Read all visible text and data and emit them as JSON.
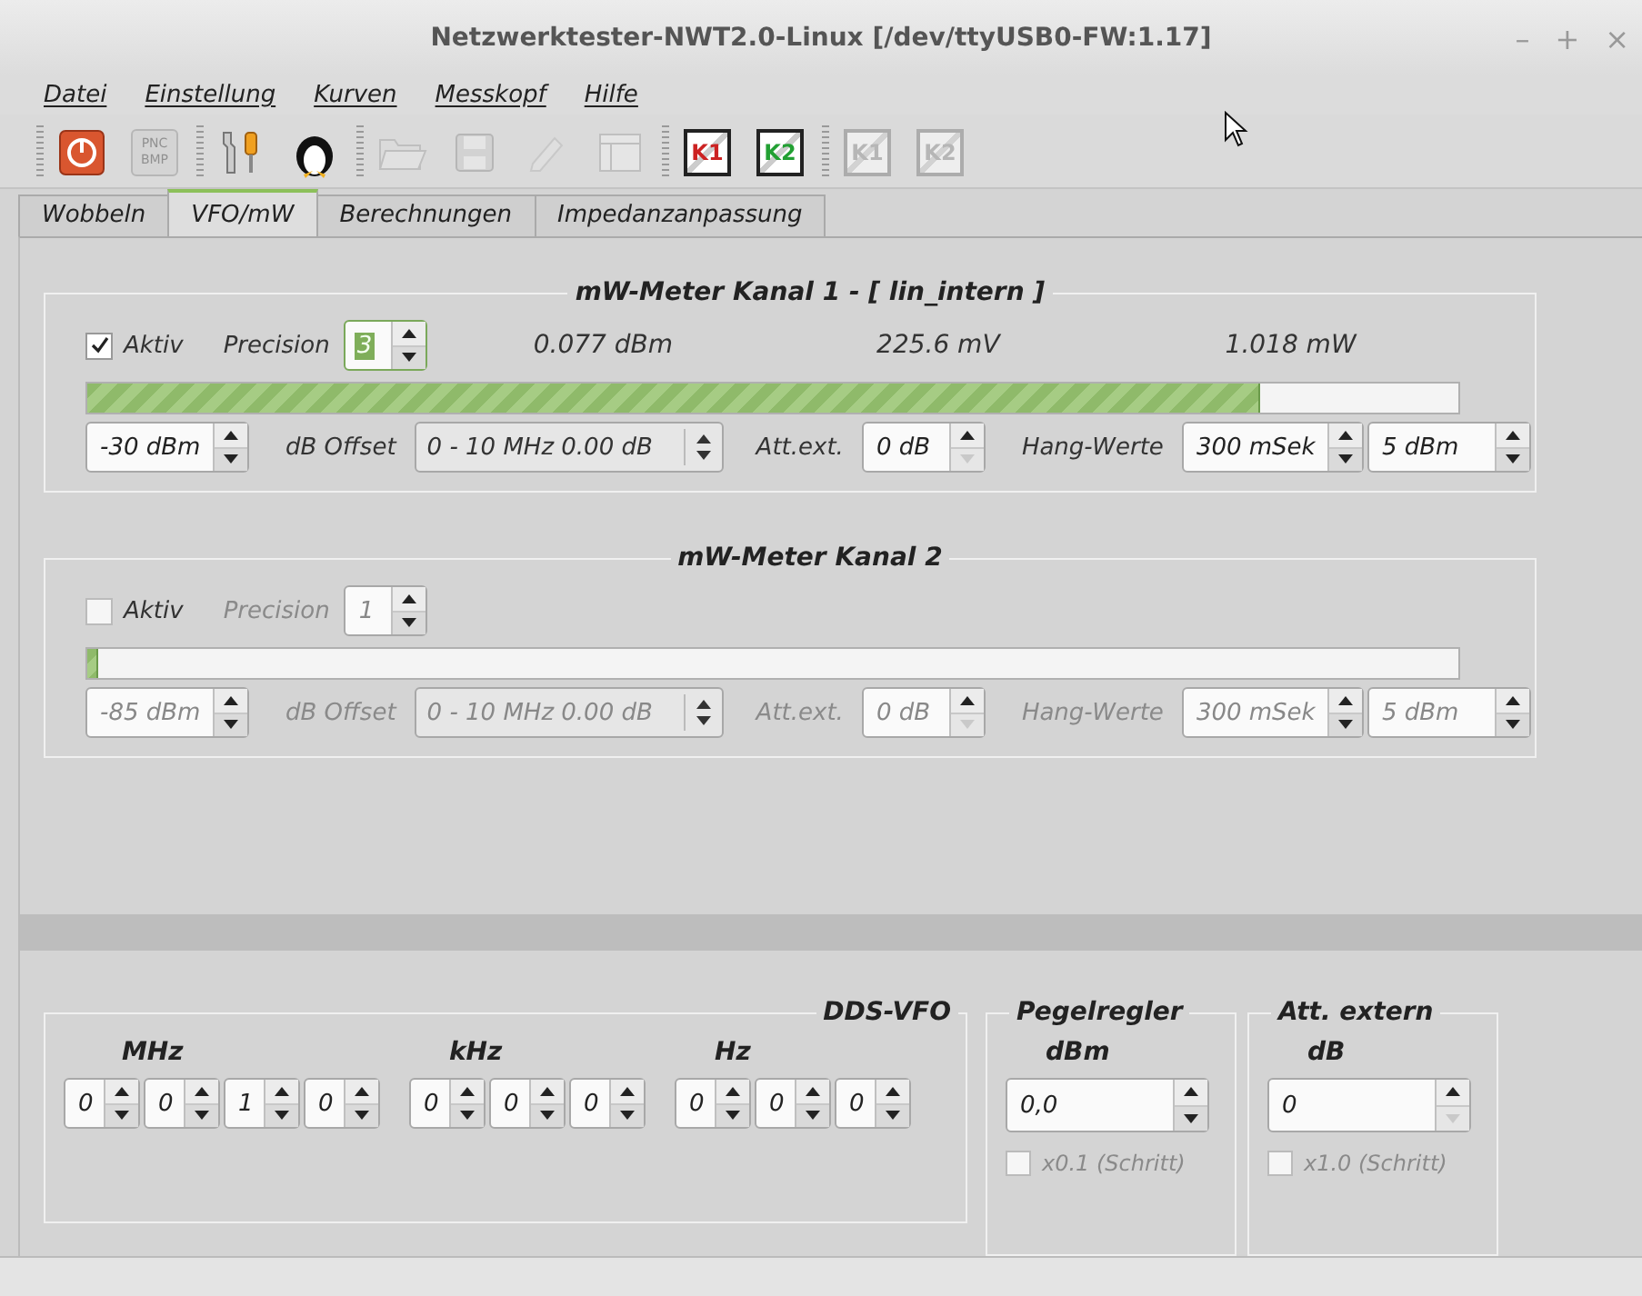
{
  "window": {
    "title": "Netzwerktester-NWT2.0-Linux [/dev/ttyUSB0-FW:1.17]",
    "controls": [
      "–",
      "+",
      "×"
    ]
  },
  "menu": [
    {
      "label": "Datei"
    },
    {
      "label": "Einstellung"
    },
    {
      "label": "Kurven"
    },
    {
      "label": "Messkopf"
    },
    {
      "label": "Hilfe"
    }
  ],
  "toolbar": [
    [
      {
        "kind": "power",
        "disabled": false
      },
      {
        "kind": "pnc",
        "label": "PNC BMP",
        "disabled": true
      }
    ],
    [
      {
        "kind": "tools",
        "disabled": false
      },
      {
        "kind": "penguin",
        "disabled": false
      }
    ],
    [
      {
        "kind": "folder",
        "disabled": true
      },
      {
        "kind": "floppy",
        "disabled": true
      },
      {
        "kind": "pencil",
        "disabled": true
      },
      {
        "kind": "window",
        "disabled": true
      }
    ],
    [
      {
        "kind": "probe",
        "label": "K1",
        "color": "#cc2222",
        "disabled": false
      },
      {
        "kind": "probe",
        "label": "K2",
        "color": "#22a033",
        "disabled": false
      }
    ],
    [
      {
        "kind": "probe",
        "label": "K1",
        "disabled": true
      },
      {
        "kind": "probe",
        "label": "K2",
        "disabled": true
      }
    ]
  ],
  "tabs": [
    {
      "label": "Wobbeln",
      "selected": false
    },
    {
      "label": "VFO/mW",
      "selected": true
    },
    {
      "label": "Berechnungen",
      "selected": false
    },
    {
      "label": "Impedanzanpassung",
      "selected": false
    }
  ],
  "meters": [
    {
      "title": "mW-Meter Kanal 1 - [ lin_intern ]",
      "aktiv": {
        "label": "Aktiv",
        "checked": true
      },
      "precision_label": "Precision",
      "precision": {
        "value": "3",
        "focused": true
      },
      "readings": [
        "0.077 dBm",
        "225.6 mV",
        "1.018 mW"
      ],
      "level": 0.856,
      "offset": "-30 dBm",
      "offset_label": "dB Offset",
      "band": "0 - 10 MHz 0.00 dB",
      "att_label": "Att.ext.",
      "att": {
        "value": "0 dB",
        "down_disabled": true
      },
      "hang_label": "Hang-Werte",
      "hang": [
        "300 mSek",
        "5 dBm"
      ]
    },
    {
      "title": "mW-Meter Kanal 2",
      "aktiv": {
        "label": "Aktiv",
        "checked": false
      },
      "precision_label": "Precision",
      "precision": {
        "value": "1",
        "focused": false
      },
      "level": 0.008,
      "offset": "-85 dBm",
      "offset_label": "dB Offset",
      "band": "0 - 10 MHz 0.00 dB",
      "att_label": "Att.ext.",
      "att": {
        "value": "0 dB",
        "down_disabled": true
      },
      "hang_label": "Hang-Werte",
      "hang": [
        "300 mSek",
        "5 dBm"
      ]
    }
  ],
  "vfo": {
    "title": "DDS-VFO",
    "groups": [
      {
        "unit": "MHz",
        "digits": [
          "0",
          "0",
          "1",
          "0"
        ]
      },
      {
        "unit": "kHz",
        "digits": [
          "0",
          "0",
          "0"
        ]
      },
      {
        "unit": "Hz",
        "digits": [
          "0",
          "0",
          "0"
        ]
      }
    ]
  },
  "side_controls": [
    {
      "title": "Pegelregler",
      "unit": "dBm",
      "value": "0,0",
      "down_disabled": false,
      "step": {
        "label": "x0.1 (Schritt)",
        "checked": false
      }
    },
    {
      "title": "Att. extern",
      "unit": "dB",
      "value": "0",
      "down_disabled": true,
      "step": {
        "label": "x1.0 (Schritt)",
        "checked": false
      }
    }
  ]
}
